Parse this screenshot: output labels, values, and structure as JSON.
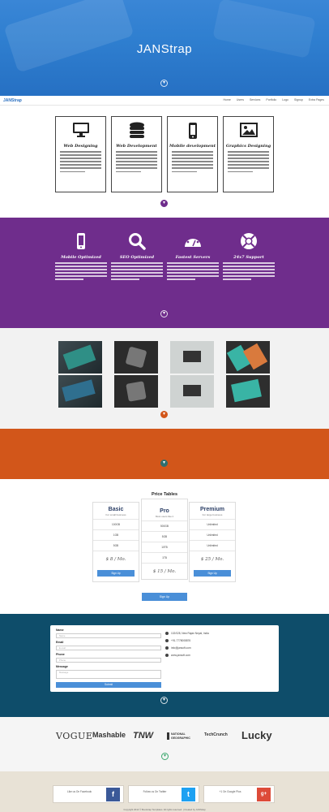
{
  "hero": {
    "title": "JANStrap"
  },
  "nav": {
    "brand": "JANStrap",
    "items": [
      "Home",
      "Users",
      "Services",
      "Portfolio",
      "Logo",
      "Signup",
      "Extra Pages"
    ]
  },
  "services": [
    {
      "title": "Web Designing",
      "icon": "monitor-icon"
    },
    {
      "title": "Web Development",
      "icon": "database-icon"
    },
    {
      "title": "Mobile development",
      "icon": "phone-icon"
    },
    {
      "title": "Graphics Designing",
      "icon": "image-icon"
    }
  ],
  "features": [
    {
      "title": "Mobile Optimized",
      "icon": "phone-icon"
    },
    {
      "title": "SEO Optimized",
      "icon": "magnifier-icon"
    },
    {
      "title": "Fastest Servers",
      "icon": "dashboard-icon"
    },
    {
      "title": "24x7 Support",
      "icon": "lifebuoy-icon"
    }
  ],
  "pricing": {
    "title": "Price Tables",
    "plans": [
      {
        "name": "Basic",
        "subtitle": "For small business",
        "rows": [
          "100GB",
          "1GB",
          "5GB"
        ],
        "price": "$ 8 / Mo.",
        "button": "Sign Up"
      },
      {
        "name": "Pro",
        "subtitle": "Most users like it",
        "rows": [
          "500GB",
          "5GB",
          "10TB",
          "1TB"
        ],
        "price": "$ 15 / Mo.",
        "button": "Sign Up"
      },
      {
        "name": "Premium",
        "subtitle": "For large business",
        "rows": [
          "Unlimited",
          "Unlimited",
          "Unlimited"
        ],
        "price": "$ 25 / Mo.",
        "button": "Sign Up"
      }
    ],
    "big_button": "Sign Up"
  },
  "contact": {
    "labels": {
      "name": "Name",
      "email": "Email",
      "phone": "Phone",
      "message": "Message"
    },
    "placeholders": {
      "name": "Name",
      "email": "E-mail",
      "phone": "Phone",
      "message": "Message"
    },
    "submit": "Submit",
    "info": [
      "102/028, New Rajan Nepal, India",
      "+91-7778008876",
      "info@jansoft.com",
      "www.jansoft.com"
    ]
  },
  "logos": [
    "VOGUE",
    "Mashable",
    "TNW",
    "NATIONAL GEOGRAPHIC",
    "TechCrunch",
    "Lucky"
  ],
  "social": [
    {
      "text": "Like us On Facebook",
      "icon": "f"
    },
    {
      "text": "Follow us On Twitter",
      "icon": "t"
    },
    {
      "text": "+1 On Google Plus",
      "icon": "g+"
    }
  ],
  "footer": {
    "copyright": "Copyright 2014 © Bootstrap Templates. All rights reserved. | Created by JANStrap"
  },
  "colors": {
    "hero": "#2f7fd0",
    "purple": "#6f2d8c",
    "orange": "#d2561a",
    "teal": "#0e4d6a",
    "accent": "#4a8fd8"
  }
}
